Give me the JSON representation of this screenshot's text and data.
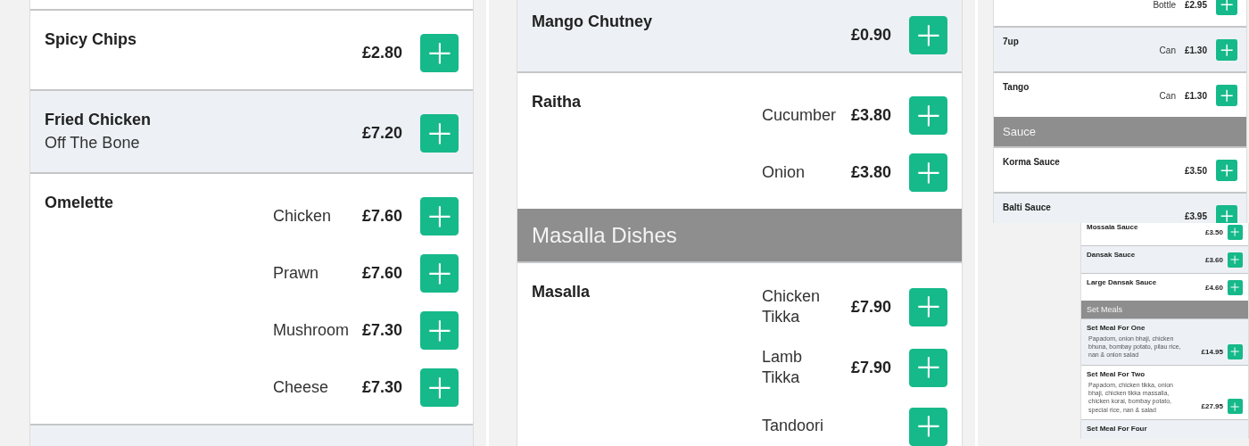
{
  "panels": [
    {
      "kind": "large",
      "rows": [
        {
          "kind": "item",
          "name": "Spicy Chips",
          "shaded": false,
          "variants": [
            {
              "price": "£2.80"
            }
          ]
        },
        {
          "kind": "item",
          "name": "Fried Chicken",
          "subtitle": "Off The Bone",
          "shaded": true,
          "variants": [
            {
              "price": "£7.20"
            }
          ]
        },
        {
          "kind": "item",
          "name": "Omelette",
          "shaded": false,
          "variants": [
            {
              "label": "Chicken",
              "price": "£7.60"
            },
            {
              "label": "Prawn",
              "price": "£7.60"
            },
            {
              "label": "Mushroom",
              "price": "£7.30"
            },
            {
              "label": "Cheese",
              "price": "£7.30"
            }
          ]
        },
        {
          "kind": "item",
          "shaded": true,
          "variants": []
        }
      ]
    },
    {
      "kind": "large",
      "rows": [
        {
          "kind": "item",
          "name": "Mango Chutney",
          "shaded": true,
          "variants": [
            {
              "price": "£0.90"
            }
          ]
        },
        {
          "kind": "item",
          "name": "Raitha",
          "shaded": false,
          "variants": [
            {
              "label": "Cucumber",
              "price": "£3.80"
            },
            {
              "label": "Onion",
              "price": "£3.80"
            }
          ]
        },
        {
          "kind": "header",
          "title": "Masalla Dishes"
        },
        {
          "kind": "item",
          "name": "Masalla",
          "shaded": false,
          "variants": [
            {
              "label": "Chicken Tikka",
              "price": "£7.90"
            },
            {
              "label": "Lamb Tikka",
              "price": "£7.90"
            },
            {
              "label": "Tandoori"
            }
          ]
        }
      ]
    },
    {
      "kind": "small",
      "rows": [
        {
          "kind": "item",
          "shaded": false,
          "variants": [
            {
              "label": "Bottle",
              "price": "£2.95"
            }
          ]
        },
        {
          "kind": "item",
          "name": "7up",
          "shaded": true,
          "variants": [
            {
              "label": "Can",
              "price": "£1.30"
            }
          ]
        },
        {
          "kind": "item",
          "name": "Tango",
          "shaded": false,
          "variants": [
            {
              "label": "Can",
              "price": "£1.30"
            }
          ]
        },
        {
          "kind": "header",
          "title": "Sauce"
        },
        {
          "kind": "item",
          "name": "Korma Sauce",
          "shaded": false,
          "variants": [
            {
              "price": "£3.50"
            }
          ]
        },
        {
          "kind": "item",
          "name": "Balti Sauce",
          "shaded": true,
          "variants": [
            {
              "price": "£3.95"
            }
          ]
        }
      ]
    },
    {
      "kind": "tiny",
      "rows": [
        {
          "kind": "item",
          "name": "Mossala Sauce",
          "shaded": false,
          "variants": [
            {
              "price": "£3.50"
            }
          ]
        },
        {
          "kind": "item",
          "name": "Dansak Sauce",
          "shaded": true,
          "variants": [
            {
              "price": "£3.60"
            }
          ]
        },
        {
          "kind": "item",
          "name": "Large Dansak Sauce",
          "shaded": false,
          "variants": [
            {
              "price": "£4.60"
            }
          ]
        },
        {
          "kind": "header",
          "title": "Set Meals"
        },
        {
          "kind": "item",
          "name": "Set Meal For One",
          "description": "Papadom, onion bhaji, chicken bhuna, bombay potato, pilau rice, nan & onion salad",
          "shaded": true,
          "variants": [
            {
              "price": "£14.95"
            }
          ]
        },
        {
          "kind": "item",
          "name": "Set Meal For Two",
          "description": "Papadom, chicken tikka, onion bhaji, chicken tikka massalla, chicken korai, bombay potato, special rice, nan & salad",
          "shaded": false,
          "variants": [
            {
              "price": "£27.95"
            }
          ]
        },
        {
          "kind": "item",
          "name": "Set Meal For Four",
          "shaded": true,
          "variants": []
        }
      ]
    }
  ]
}
